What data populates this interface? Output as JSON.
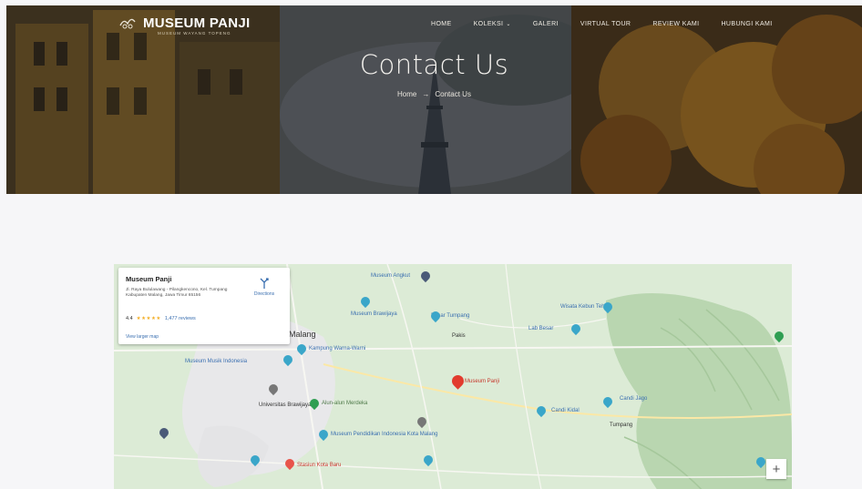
{
  "brand": {
    "name": "MUSEUM PANJI",
    "tagline": "MUSEUM WAYANG TOPENG",
    "logo_icon": "mask-logo-icon"
  },
  "nav": {
    "items": [
      {
        "label": "HOME"
      },
      {
        "label": "KOLEKSI",
        "has_dropdown": true
      },
      {
        "label": "GALERI"
      },
      {
        "label": "VIRTUAL TOUR"
      },
      {
        "label": "REVIEW KAMI"
      },
      {
        "label": "HUBUNGI KAMI"
      }
    ]
  },
  "hero": {
    "title": "Contact Us",
    "breadcrumb": {
      "home": "Home",
      "separator": "→",
      "current": "Contact Us"
    }
  },
  "map": {
    "place_card": {
      "title": "Museum Panji",
      "address": "Jl. Raya Bululawang - Pilangkencono, Kel. Tumpang Kabupaten Malang, Jawa Timur 65156",
      "rating": "4.4",
      "stars": "★★★★★",
      "reviews": "1,477 reviews",
      "view_larger": "View larger map",
      "directions": "Directions"
    },
    "labels": [
      "Malang",
      "Museum Musik Indonesia",
      "Kampung Warna-Warni",
      "Museum Panji",
      "Museum Brawijaya",
      "Museum Pendidikan Indonesia Kota Malang",
      "Museum Angkut",
      "Pakis",
      "Tumpang",
      "Wisata Kebun Teh",
      "Candi Jago",
      "Pasar Tumpang",
      "Lab Besar",
      "Universitas Brawijaya",
      "Alun-alun Merdeka",
      "Candi Kidal",
      "Stasiun Kota Baru"
    ],
    "zoom_label": "+"
  },
  "colors": {
    "accent": "#e23b2e",
    "map_bg": "#dcebd6",
    "hero_overlay": "#2b261e"
  }
}
